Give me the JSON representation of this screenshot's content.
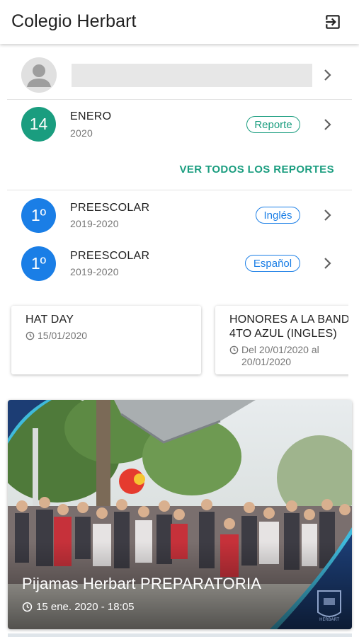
{
  "app": {
    "title": "Colegio Herbart",
    "logout_icon": "logout-icon"
  },
  "profile": {
    "avatar_icon": "person-avatar-icon",
    "name": ""
  },
  "report": {
    "day": "14",
    "month": "ENERO",
    "year": "2020",
    "badge": "Reporte",
    "badge_color": "#1a9d7f"
  },
  "view_all_reports": "VER TODOS LOS REPORTES",
  "groups": [
    {
      "grade": "1º",
      "level": "PREESCOLAR",
      "period": "2019-2020",
      "language": "Inglés",
      "color": "#1a7ee6"
    },
    {
      "grade": "1º",
      "level": "PREESCOLAR",
      "period": "2019-2020",
      "language": "Español",
      "color": "#1a7ee6"
    }
  ],
  "events": [
    {
      "title": "HAT DAY",
      "date": "15/01/2020"
    },
    {
      "title": "HONORES A LA BAND\n4TO AZUL (INGLES)",
      "date": "Del 20/01/2020 al 20/01/2020"
    }
  ],
  "news": {
    "title": "Pijamas Herbart PREPARATORIA",
    "date": "15 ene. 2020 - 18:05",
    "logo_text": "HERBART"
  },
  "colors": {
    "accent_teal": "#1a9d7f",
    "accent_blue": "#1a7ee6"
  }
}
